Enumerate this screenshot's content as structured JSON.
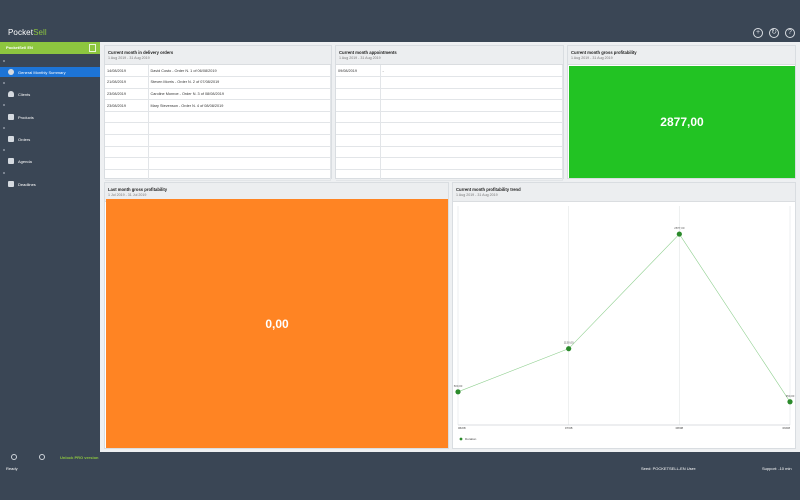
{
  "app": {
    "name_part1": "Pocket",
    "name_part2": "Sell",
    "icons": [
      "add-icon",
      "refresh-icon",
      "help-icon"
    ]
  },
  "sidebar": {
    "header_label": "PocketSell EN",
    "items": [
      {
        "label": "General Monthly Summary",
        "icon": "summary-icon",
        "active": true
      },
      {
        "label": "Clients",
        "icon": "person-icon",
        "active": false
      },
      {
        "label": "Products",
        "icon": "product-icon",
        "active": false
      },
      {
        "label": "Orders",
        "icon": "orders-icon",
        "active": false
      },
      {
        "label": "Agenda",
        "icon": "agenda-icon",
        "active": false
      },
      {
        "label": "Deadlines",
        "icon": "deadlines-icon",
        "active": false
      }
    ]
  },
  "bottom": {
    "settings_icon": "settings-icon",
    "info_icon": "upgrade-icon",
    "unlock_label": "Unlock PRO version"
  },
  "status": {
    "ready": "Ready",
    "seed": "Seed: POCKETSELL-EN  User:",
    "support": "Support: -10 min"
  },
  "colors": {
    "accent_green": "#8dc63f",
    "active_blue": "#1d74d6",
    "metric_green": "#22c323",
    "metric_orange": "#ff8423",
    "trend_point": "#2b8a2b"
  },
  "panels": {
    "delivery": {
      "title": "Current month in delivery orders",
      "subtitle": "1 Aug 2019 - 31 Aug 2019",
      "rows": [
        {
          "date": "14/08/2019",
          "desc": "David Costo -  Order N. 1 of 06/08/2019"
        },
        {
          "date": "21/08/2019",
          "desc": "Steven Morris -  Order N. 2 of 07/08/2019"
        },
        {
          "date": "23/08/2019",
          "desc": "Caroline Monroe -  Order N. 3 of 08/08/2019"
        },
        {
          "date": "23/08/2019",
          "desc": "Mary Stevenson -  Order N. 4 of 08/08/2019"
        },
        {
          "date": "",
          "desc": ""
        },
        {
          "date": "",
          "desc": ""
        },
        {
          "date": "",
          "desc": ""
        },
        {
          "date": "",
          "desc": ""
        },
        {
          "date": "",
          "desc": ""
        },
        {
          "date": "",
          "desc": ""
        }
      ]
    },
    "appointments": {
      "title": "Current month appointments",
      "subtitle": "1 Aug 2019 - 31 Aug 2019",
      "rows": [
        {
          "date": "09/08/2019",
          "desc": "-"
        },
        {
          "date": "",
          "desc": ""
        },
        {
          "date": "",
          "desc": ""
        },
        {
          "date": "",
          "desc": ""
        },
        {
          "date": "",
          "desc": ""
        },
        {
          "date": "",
          "desc": ""
        },
        {
          "date": "",
          "desc": ""
        },
        {
          "date": "",
          "desc": ""
        },
        {
          "date": "",
          "desc": ""
        },
        {
          "date": "",
          "desc": ""
        }
      ]
    },
    "gross_current": {
      "title": "Current month gross profitability",
      "subtitle": "1 Aug 2019 - 31 Aug 2019",
      "value": "2877,00"
    },
    "gross_last": {
      "title": "Last month gross profitability",
      "subtitle": "1 Jul 2019 - 31 Jul 2019",
      "value": "0,00"
    },
    "trend": {
      "title": "Current month profitability trend",
      "subtitle": "1 Aug 2019 - 31 Aug 2019"
    }
  },
  "chart_data": {
    "type": "line",
    "x": [
      "06/08",
      "07/08",
      "08/08",
      "09/08"
    ],
    "series": [
      {
        "name": "Duration",
        "values": [
          500,
          1150,
          2877,
          350
        ],
        "point_labels": [
          "500,00",
          "1150,00",
          "2877,00",
          "350,00"
        ]
      }
    ],
    "ylim": [
      0,
      3300
    ],
    "grid": "vertical",
    "legend": "bottom-left"
  }
}
